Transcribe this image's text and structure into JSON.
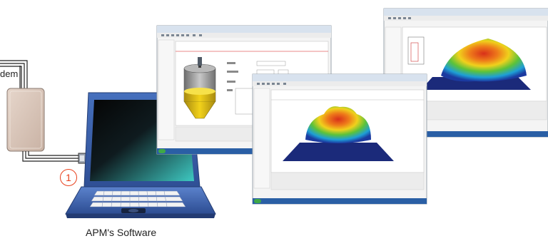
{
  "labels": {
    "modem": "dem",
    "step_number": "1",
    "software_caption": "APM's Software"
  },
  "screens": [
    {
      "name": "silo-configuration-screen",
      "view": "silo level measurement"
    },
    {
      "name": "surface-3d-screen-center",
      "view": "3D surface map"
    },
    {
      "name": "surface-3d-screen-right",
      "view": "3D surface map"
    }
  ],
  "colors": {
    "laptop_body": "#3b5fa8",
    "laptop_screen_dark": "#050505",
    "laptop_screen_light": "#3ec9c2",
    "modem_box": "#d6c3b6",
    "badge": "#e8401c",
    "surface_base": "#1b2a7a",
    "surface_low": "#1e9fd6",
    "surface_mid": "#f0d11c",
    "surface_high": "#d8301a"
  }
}
